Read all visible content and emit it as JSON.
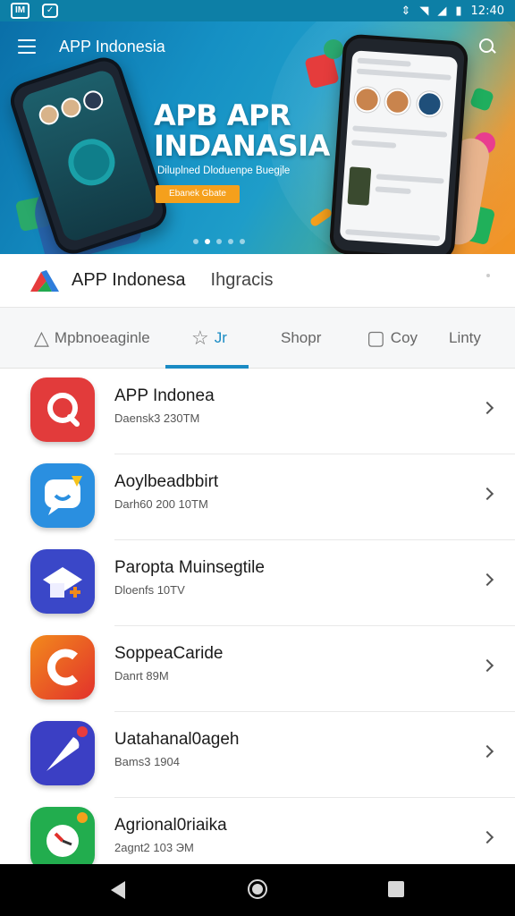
{
  "status_bar": {
    "badge_text": "IM",
    "time": "12:40",
    "icons": [
      "wifi-icon",
      "signal-icon",
      "battery-icon"
    ]
  },
  "hero": {
    "app_title": "APP Indonesia",
    "headline_line1": "APB APR",
    "headline_line2": "INDANASIA",
    "subtitle": "Diluplned Dloduenpe Buegjle",
    "cta_label": "Ebanek Gbate",
    "slides_total": 5,
    "active_slide": 1
  },
  "header": {
    "brand_name": "APP Indonesa",
    "tagline": "Ihgracis"
  },
  "tabs": [
    {
      "label": "Mpbnoeaginle",
      "icon": "alert-triangle-icon"
    },
    {
      "label": "Jr",
      "icon": "star-icon"
    },
    {
      "label": "Shopr",
      "icon": ""
    },
    {
      "label": "Coy",
      "icon": "chat-icon"
    },
    {
      "label": "Linty",
      "icon": ""
    }
  ],
  "active_tab": 1,
  "apps": [
    {
      "name": "APP Indonea",
      "meta": "Daensk3 230TM"
    },
    {
      "name": "Aoylbeadbbirt",
      "meta": "Darh60 200 10TM"
    },
    {
      "name": "Paropta Muinsegtile",
      "meta": "Dloenfs 10TV"
    },
    {
      "name": "SoppeaCaride",
      "meta": "Danrt 89M"
    },
    {
      "name": "Uatahanal0ageh",
      "meta": "Bams3 1904"
    },
    {
      "name": "Agrional0riaika",
      "meta": "2agnt2 103 ЭM"
    }
  ],
  "colors": {
    "accent": "#1a8bc4",
    "status_bar": "#0d7fa6",
    "cta": "#f5a01c",
    "nav_bar": "#000000"
  }
}
